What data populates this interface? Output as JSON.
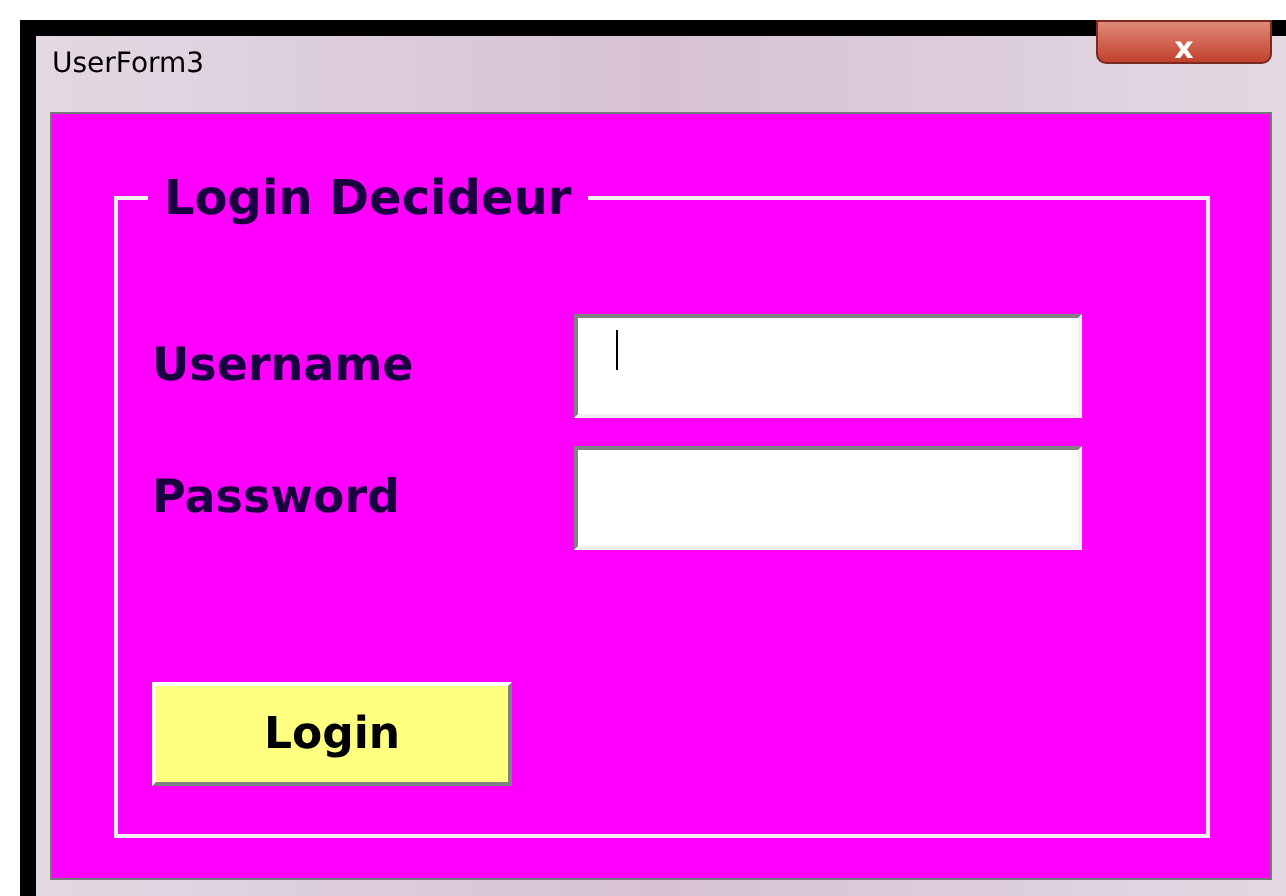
{
  "window": {
    "title": "UserForm3",
    "close_button": "x"
  },
  "frame": {
    "title": "Login Decideur"
  },
  "fields": [
    {
      "label": "Username",
      "focused": true
    },
    {
      "label": "Password",
      "focused": false
    }
  ],
  "buttons": [
    "Login"
  ]
}
